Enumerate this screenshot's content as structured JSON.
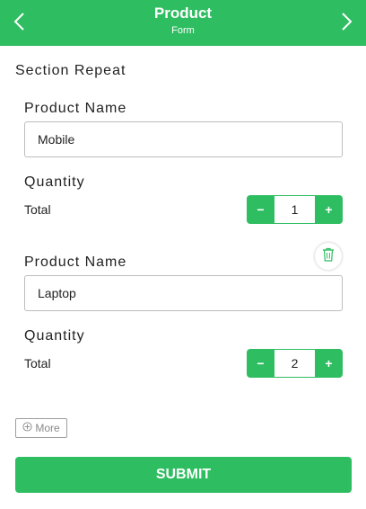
{
  "header": {
    "title": "Product",
    "subtitle": "Form",
    "back_icon": "chevron-left-icon",
    "next_icon": "chevron-right-icon",
    "background": "#2fbd62"
  },
  "section": {
    "title": "Section Repeat"
  },
  "items": [
    {
      "product_label": "Product Name",
      "product_value": "Mobile",
      "quantity_label": "Quantity",
      "total_label": "Total",
      "quantity": "1",
      "minus": "−",
      "plus": "+"
    },
    {
      "product_label": "Product Name",
      "product_value": "Laptop",
      "quantity_label": "Quantity",
      "total_label": "Total",
      "quantity": "2",
      "minus": "−",
      "plus": "+",
      "delete_icon": "trash-icon"
    }
  ],
  "more": {
    "label": "More",
    "icon": "plus-circle-icon"
  },
  "submit": {
    "label": "SUBMIT"
  }
}
